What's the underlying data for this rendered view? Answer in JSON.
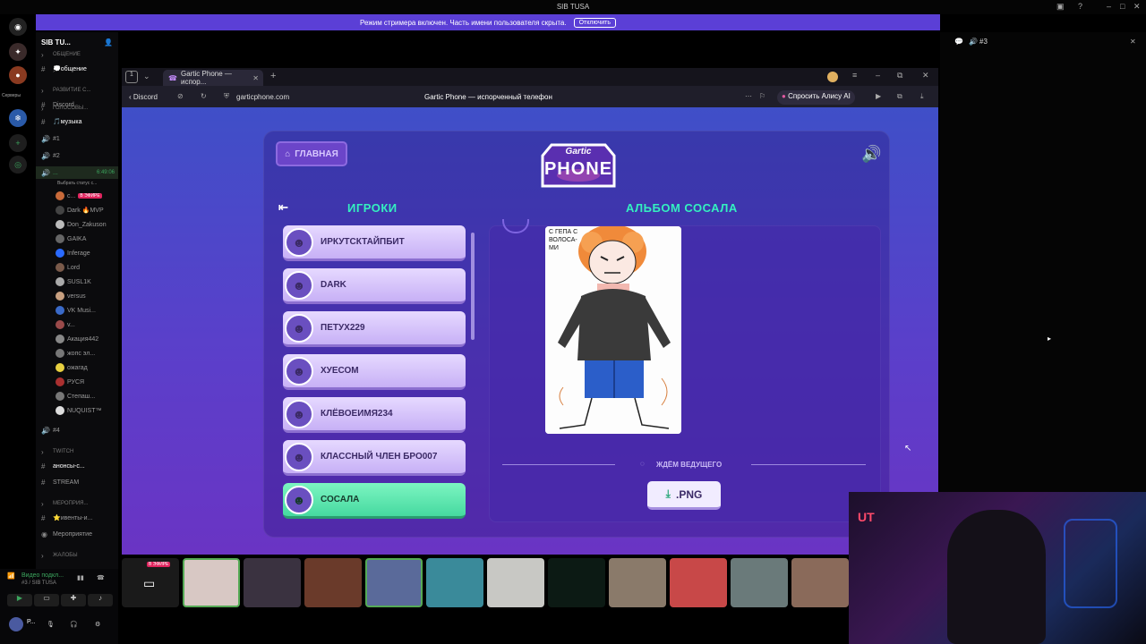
{
  "window": {
    "title": "SIB TUSA"
  },
  "stream_banner": {
    "text": "Режим стримера включен. Часть имени пользователя скрыта.",
    "button": "Отключить"
  },
  "servers": {
    "label": "Серверы"
  },
  "channels": {
    "server_name": "SIB TU...",
    "items": [
      {
        "type": "cat",
        "label": "ОБЩЕНИЕ"
      },
      {
        "type": "text",
        "label": "💭общение"
      },
      {
        "type": "cat",
        "label": "РАЗВИТИЕ С..."
      },
      {
        "type": "text",
        "label": "Discord"
      },
      {
        "type": "cat",
        "label": "ГОЛОСОВЫ..."
      },
      {
        "type": "text",
        "label": "🎵музыка"
      },
      {
        "type": "voice",
        "label": "#1"
      },
      {
        "type": "voice",
        "label": "#2"
      },
      {
        "type": "voice",
        "label": "...",
        "time": "6:49:06",
        "status": "Выбрать статус с..."
      }
    ],
    "users": [
      {
        "name": "c...",
        "live": "В ЭФИРЕ"
      },
      {
        "name": "Dark 🔥MVP"
      },
      {
        "name": "Don_Zakuson"
      },
      {
        "name": "GAIKA"
      },
      {
        "name": "Inferage"
      },
      {
        "name": "Lord"
      },
      {
        "name": "SUSL1K"
      },
      {
        "name": "versus"
      },
      {
        "name": "VK Musi..."
      },
      {
        "name": "v..."
      },
      {
        "name": "Акация442"
      },
      {
        "name": "жопс эл..."
      },
      {
        "name": "ожагад"
      },
      {
        "name": "РУСЯ"
      },
      {
        "name": "Степаш..."
      },
      {
        "name": "NUQUIST™"
      }
    ],
    "after": [
      {
        "type": "voice",
        "label": "#4"
      },
      {
        "type": "cat",
        "label": "TWITCH"
      },
      {
        "type": "text",
        "label": "анонсы-с..."
      },
      {
        "type": "text",
        "label": "STREAM"
      },
      {
        "type": "cat",
        "label": "МЕРОПРИЯ..."
      },
      {
        "type": "text",
        "label": "⭐ивенты-и..."
      },
      {
        "type": "text",
        "label": "Мероприятие"
      },
      {
        "type": "cat",
        "label": "ЖАЛОБЫ"
      }
    ]
  },
  "user_panel": {
    "status": "Видео подкл...",
    "channel": "#3 / SIB TUSA",
    "name": "P..."
  },
  "right_panel": {
    "channel": "#3"
  },
  "browser": {
    "tab_count": "1",
    "tab_title": "Gartic Phone — испор...",
    "back_label": "Discord",
    "url": "garticphone.com",
    "page_title": "Gartic Phone — испорченный телефон",
    "alice": "Спросить Алису AI"
  },
  "game": {
    "home_label": "ГЛАВНАЯ",
    "logo_top": "Gartic",
    "logo_bottom": "PHONE",
    "players_header": "ИГРОКИ",
    "album_header": "АЛЬБОМ СОСАЛА",
    "players": [
      {
        "name": "ИРКУТСКТАЙПБИТ",
        "me": false
      },
      {
        "name": "DARK",
        "me": false
      },
      {
        "name": "ПЕТУХ229",
        "me": false
      },
      {
        "name": "ХУЕСОМ",
        "me": false
      },
      {
        "name": "КЛЁВОЕИМЯ234",
        "me": false
      },
      {
        "name": "КЛАССНЫЙ ЧЛЕН БРО007",
        "me": false
      },
      {
        "name": "СОСАЛА",
        "me": true
      }
    ],
    "drawing_text": "С ГЕПА С ВОЛОСА- МИ",
    "waiting": "ЖДЁМ ВЕДУЩЕГО",
    "png_label": ".PNG"
  },
  "video_strip": {
    "live_badge": "В ЭФИРЕ"
  },
  "colors": {
    "accent": "#5b3fd6",
    "teal": "#34f0c0",
    "live": "#e0245e"
  }
}
